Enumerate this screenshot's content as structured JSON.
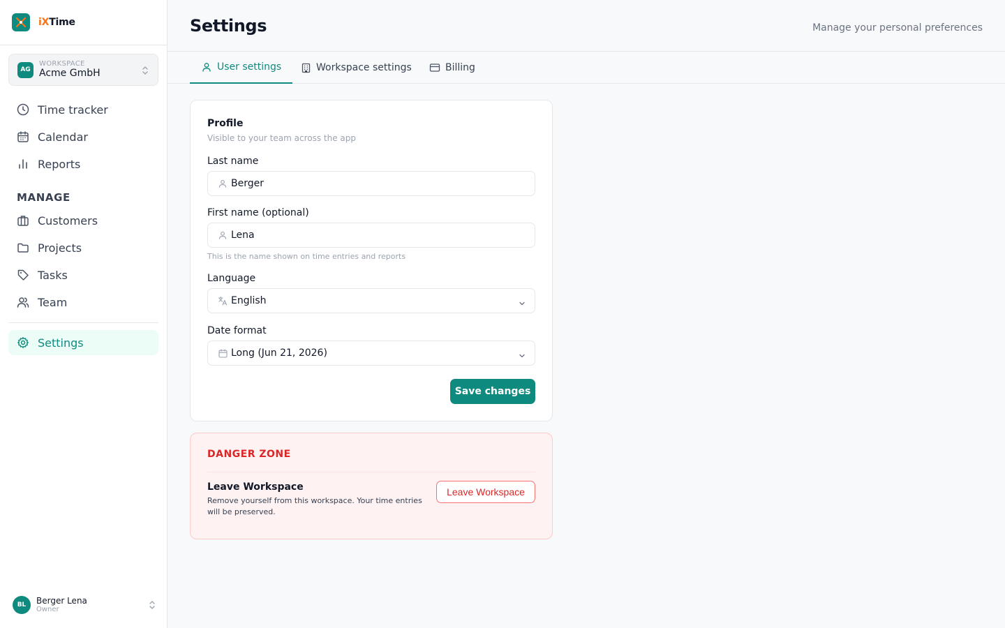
{
  "app": {
    "name_prefix": "iX",
    "name_suffix": "Time",
    "accent": "#0f8a7e",
    "accent_secondary": "#f97316"
  },
  "workspace": {
    "label": "WORKSPACE",
    "name": "Acme GmbH",
    "initials": "AG"
  },
  "sidebar": {
    "primary": [
      {
        "label": "Time tracker",
        "icon": "clock-icon"
      },
      {
        "label": "Calendar",
        "icon": "calendar-icon"
      },
      {
        "label": "Reports",
        "icon": "bar-chart-icon"
      }
    ],
    "section_label": "MANAGE",
    "manage": [
      {
        "label": "Customers",
        "icon": "briefcase-icon"
      },
      {
        "label": "Projects",
        "icon": "folder-icon"
      },
      {
        "label": "Tasks",
        "icon": "tag-icon"
      },
      {
        "label": "Team",
        "icon": "users-icon"
      }
    ],
    "settings": {
      "label": "Settings",
      "icon": "gear-icon",
      "active": true
    }
  },
  "user": {
    "name": "Berger Lena",
    "role": "Owner",
    "initials": "BL"
  },
  "header": {
    "title": "Settings",
    "subtitle": "Manage your personal preferences"
  },
  "tabs": [
    {
      "label": "User settings",
      "icon": "user-icon",
      "active": true
    },
    {
      "label": "Workspace settings",
      "icon": "building-icon",
      "active": false
    },
    {
      "label": "Billing",
      "icon": "credit-card-icon",
      "active": false
    }
  ],
  "profile": {
    "title": "Profile",
    "subtitle": "Visible to your team across the app",
    "last_name": {
      "label": "Last name",
      "value": "Berger"
    },
    "first_name": {
      "label": "First name (optional)",
      "value": "Lena"
    },
    "name_help": "This is the name shown on time entries and reports",
    "language": {
      "label": "Language",
      "value": "English"
    },
    "date_format": {
      "label": "Date format",
      "value": "Long (Jun 21, 2026)"
    },
    "save_label": "Save changes"
  },
  "danger_zone": {
    "title": "DANGER ZONE",
    "item_title": "Leave Workspace",
    "item_desc": "Remove yourself from this workspace. Your time entries will be preserved.",
    "button_label": "Leave Workspace",
    "color": "#dc2626"
  }
}
